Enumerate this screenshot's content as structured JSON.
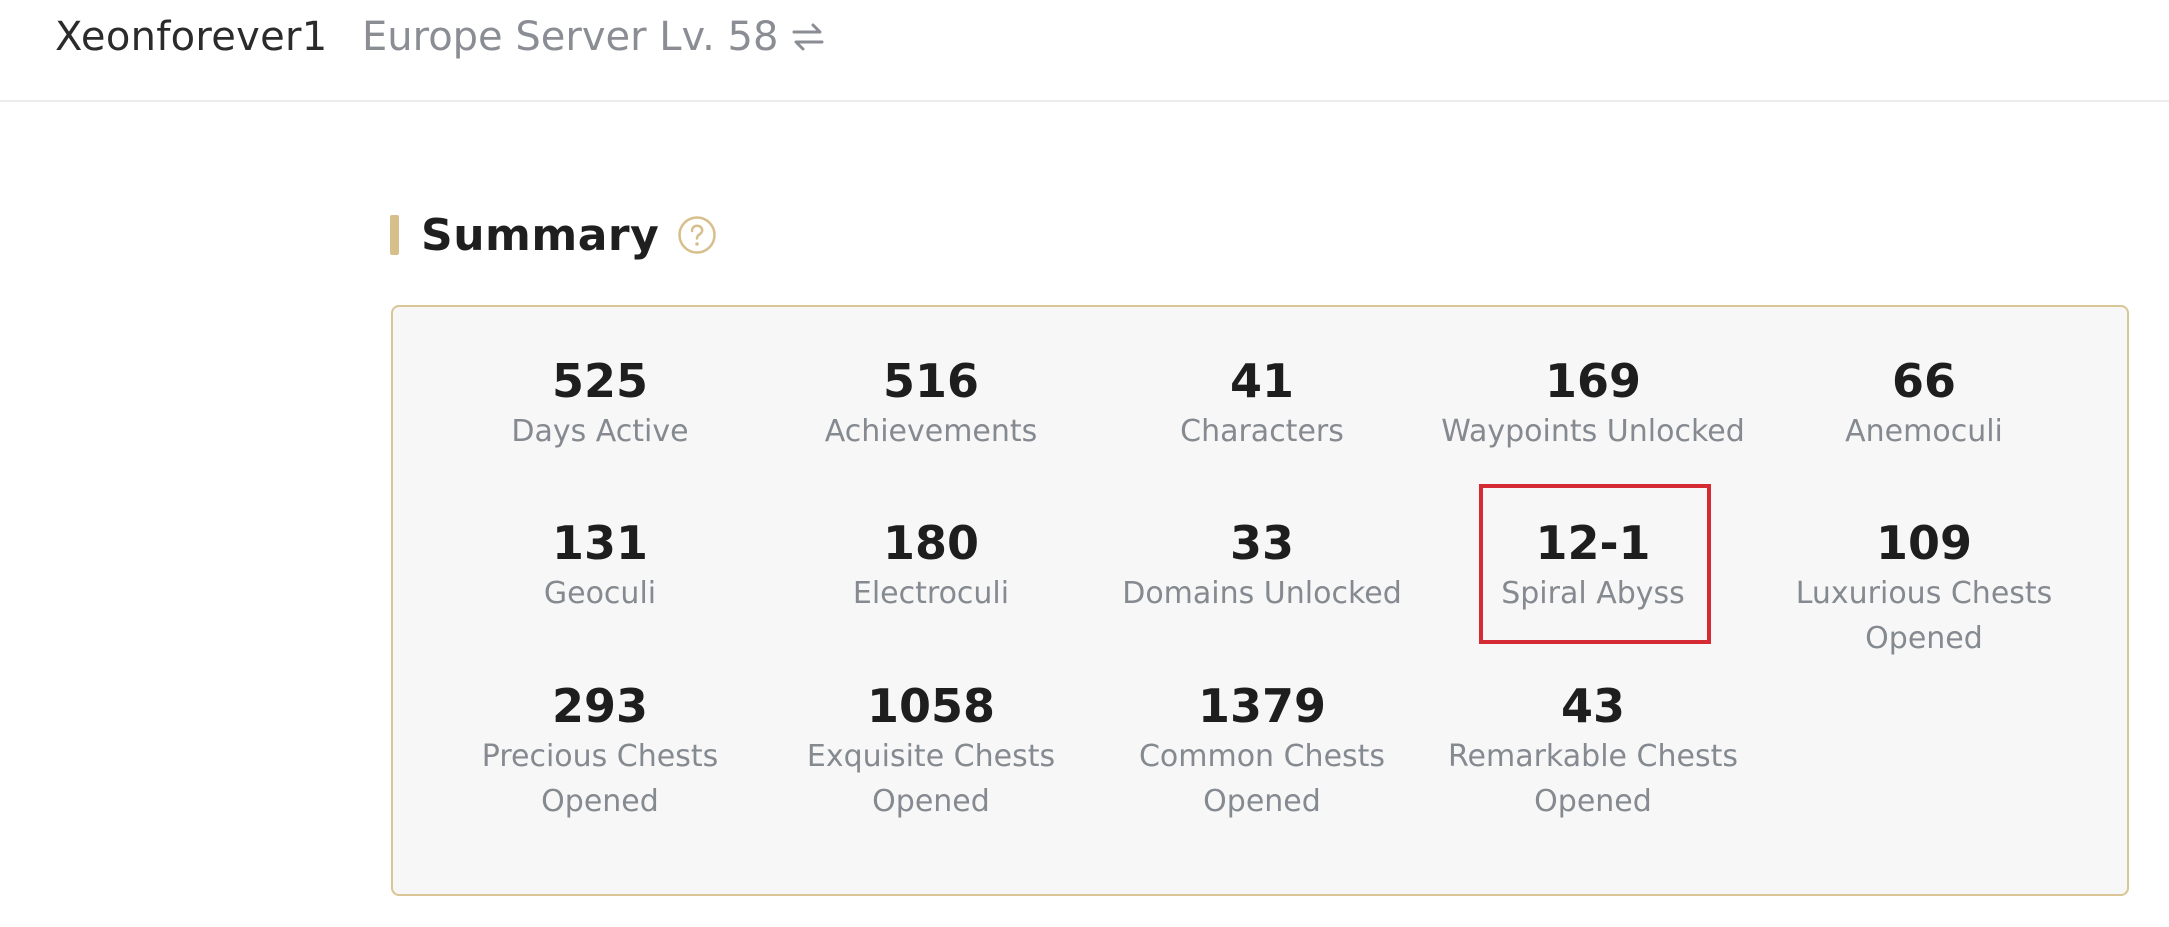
{
  "header": {
    "username": "Xeonforever1",
    "server": "Europe Server Lv. 58",
    "switch_icon": "swap-arrows-icon"
  },
  "summary": {
    "title": "Summary",
    "help_icon": "question-circle-icon",
    "accent_color": "#d7bf8c",
    "border_color": "#d9c596",
    "stats": [
      {
        "value": "525",
        "label": "Days Active"
      },
      {
        "value": "516",
        "label": "Achievements"
      },
      {
        "value": "41",
        "label": "Characters"
      },
      {
        "value": "169",
        "label": "Waypoints Unlocked"
      },
      {
        "value": "66",
        "label": "Anemoculi"
      },
      {
        "value": "131",
        "label": "Geoculi"
      },
      {
        "value": "180",
        "label": "Electroculi"
      },
      {
        "value": "33",
        "label": "Domains Unlocked"
      },
      {
        "value": "12-1",
        "label": "Spiral Abyss"
      },
      {
        "value": "109",
        "label": "Luxurious Chests Opened"
      },
      {
        "value": "293",
        "label": "Precious Chests Opened"
      },
      {
        "value": "1058",
        "label": "Exquisite Chests Opened"
      },
      {
        "value": "1379",
        "label": "Common Chests Opened"
      },
      {
        "value": "43",
        "label": "Remarkable Chests Opened"
      }
    ],
    "highlight_color": "#d52b35"
  }
}
